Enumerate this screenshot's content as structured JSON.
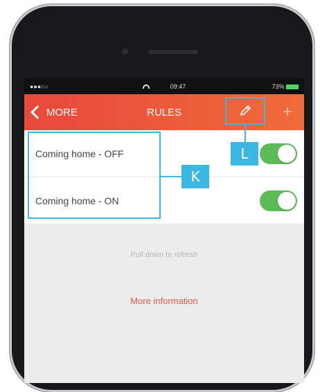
{
  "statusbar": {
    "carrier": "●●●○○",
    "time": "09:47",
    "battery": "73%"
  },
  "navbar": {
    "back_label": "MORE",
    "title": "RULES",
    "add_label": "+"
  },
  "rules": [
    {
      "label": "Coming home - OFF",
      "enabled": true
    },
    {
      "label": "Coming home - ON",
      "enabled": true
    }
  ],
  "pull_to_refresh": "Pull down to refresh",
  "more_information": "More information",
  "callouts": {
    "edit": "L",
    "rules_list": "K"
  },
  "colors": {
    "nav_start": "#e7483b",
    "nav_end": "#f06b3a",
    "toggle_on": "#5dbb57",
    "callout": "#3ab7e3",
    "link": "#e05a45"
  }
}
